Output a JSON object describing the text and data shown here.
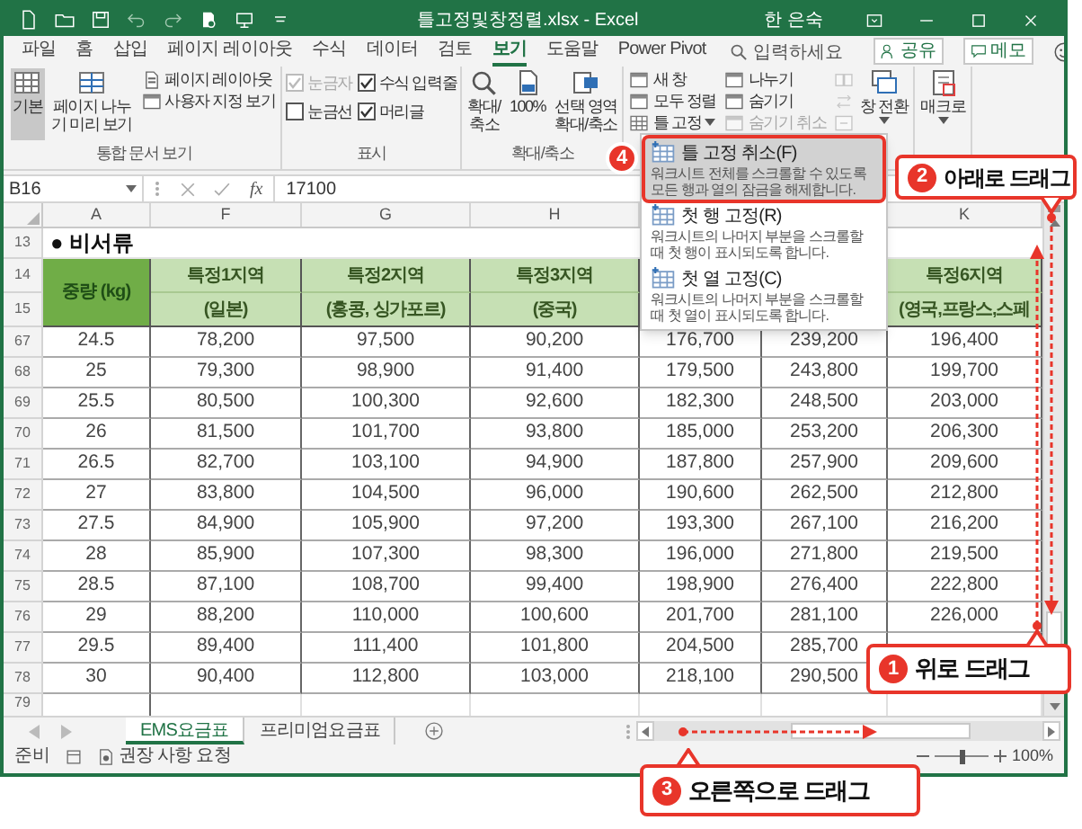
{
  "window": {
    "title": "틀고정및창정렬.xlsx - Excel",
    "user": "한 은숙"
  },
  "ribbon_tabs": [
    {
      "label": "파일",
      "selected": false
    },
    {
      "label": "홈",
      "selected": false
    },
    {
      "label": "삽입",
      "selected": false
    },
    {
      "label": "페이지 레이아웃",
      "selected": false
    },
    {
      "label": "수식",
      "selected": false
    },
    {
      "label": "데이터",
      "selected": false
    },
    {
      "label": "검토",
      "selected": false
    },
    {
      "label": "보기",
      "selected": true
    },
    {
      "label": "도움말",
      "selected": false
    },
    {
      "label": "Power Pivot",
      "selected": false
    }
  ],
  "search": {
    "placeholder": "입력하세요"
  },
  "share_button": "공유",
  "comments_button": "메모",
  "ribbon_groups": [
    {
      "label": "통합 문서 보기",
      "columns": [
        [
          {
            "kind": "large",
            "label": "기본",
            "selected": true
          }
        ],
        [
          {
            "kind": "large",
            "label": "페이지 나누\n기 미리 보기",
            "selected": false
          }
        ],
        [
          {
            "kind": "small",
            "label": "페이지 레이아웃",
            "selected": false
          },
          {
            "kind": "small",
            "label": "사용자 지정 보기",
            "selected": false
          }
        ]
      ]
    },
    {
      "label": "표시",
      "columns": [
        [
          {
            "kind": "check",
            "label": "눈금자",
            "checked": true,
            "disabled": true
          },
          {
            "kind": "check",
            "label": "눈금선",
            "checked": false,
            "disabled": false
          }
        ],
        [
          {
            "kind": "check",
            "label": "수식 입력줄",
            "checked": true,
            "disabled": false
          },
          {
            "kind": "check",
            "label": "머리글",
            "checked": true,
            "disabled": false
          }
        ]
      ]
    },
    {
      "label": "확대/축소",
      "columns": [
        [
          {
            "kind": "large",
            "label": "확대/\n축소"
          }
        ],
        [
          {
            "kind": "large",
            "label": "100%"
          }
        ],
        [
          {
            "kind": "large",
            "label": "선택 영역\n확대/축소"
          }
        ]
      ]
    },
    {
      "columns": [
        [
          {
            "kind": "small",
            "label": "새 창",
            "disabled": false
          },
          {
            "kind": "small",
            "label": "모두 정렬",
            "disabled": false
          },
          {
            "kind": "small",
            "label": "틀 고정",
            "disabled": false,
            "has_menu": true
          }
        ],
        [
          {
            "kind": "small",
            "label": "나누기",
            "disabled": false
          },
          {
            "kind": "small",
            "label": "숨기기",
            "disabled": false
          },
          {
            "kind": "small",
            "label": "숨기기 취소",
            "disabled": true
          }
        ],
        [
          {
            "kind": "icon",
            "disabled": true
          },
          {
            "kind": "icon",
            "disabled": true
          },
          {
            "kind": "icon",
            "disabled": true
          }
        ],
        [
          {
            "kind": "large",
            "label": "창 전환",
            "has_menu": true
          }
        ]
      ]
    },
    {
      "columns": [
        [
          {
            "kind": "large",
            "label": "매크로",
            "has_menu": true
          }
        ]
      ]
    }
  ],
  "freeze_menu": {
    "items": [
      {
        "title": "틀 고정 취소(F)",
        "description": "워크시트 전체를 스크롤할 수 있도록 모든 행과 열의 잠금을 해제합니다.",
        "selected": true
      },
      {
        "title": "첫 행 고정(R)",
        "description": "워크시트의 나머지 부분을 스크롤할 때 첫 행이 표시되도록 합니다.",
        "selected": false
      },
      {
        "title": "첫 열 고정(C)",
        "description": "워크시트의 나머지 부분을 스크롤할 때 첫 열이 표시되도록 합니다.",
        "selected": false
      }
    ]
  },
  "formula_bar": {
    "name_box": "B16",
    "function_label": "fx",
    "value": "17100"
  },
  "sheet": {
    "column_headers": [
      "A",
      "F",
      "G",
      "H",
      "K"
    ],
    "title_row": {
      "row": "13",
      "text": "● 비서류"
    },
    "header_rows": [
      {
        "row": "14",
        "cells": [
          "중량 (kg)",
          "특정1지역",
          "특정2지역",
          "특정3지역",
          null,
          null,
          "특정6지역"
        ]
      },
      {
        "row": "15",
        "cells": [
          null,
          "(일본)",
          "(홍콩, 싱가포르)",
          "(중국)",
          null,
          null,
          "(영국,프랑스,스페"
        ]
      }
    ],
    "rows": [
      {
        "row": "67",
        "cells": [
          "24.5",
          "78,200",
          "97,500",
          "90,200",
          "176,700",
          "239,200",
          "196,400"
        ]
      },
      {
        "row": "68",
        "cells": [
          "25",
          "79,300",
          "98,900",
          "91,400",
          "179,500",
          "243,800",
          "199,700"
        ]
      },
      {
        "row": "69",
        "cells": [
          "25.5",
          "80,500",
          "100,300",
          "92,600",
          "182,300",
          "248,500",
          "203,000"
        ]
      },
      {
        "row": "70",
        "cells": [
          "26",
          "81,500",
          "101,700",
          "93,800",
          "185,000",
          "253,200",
          "206,300"
        ]
      },
      {
        "row": "71",
        "cells": [
          "26.5",
          "82,700",
          "103,100",
          "94,900",
          "187,800",
          "257,900",
          "209,600"
        ]
      },
      {
        "row": "72",
        "cells": [
          "27",
          "83,800",
          "104,500",
          "96,000",
          "190,600",
          "262,500",
          "212,800"
        ]
      },
      {
        "row": "73",
        "cells": [
          "27.5",
          "84,900",
          "105,900",
          "97,200",
          "193,300",
          "267,100",
          "216,200"
        ]
      },
      {
        "row": "74",
        "cells": [
          "28",
          "85,900",
          "107,300",
          "98,300",
          "196,000",
          "271,800",
          "219,500"
        ]
      },
      {
        "row": "75",
        "cells": [
          "28.5",
          "87,100",
          "108,700",
          "99,400",
          "198,900",
          "276,400",
          "222,800"
        ]
      },
      {
        "row": "76",
        "cells": [
          "29",
          "88,200",
          "110,000",
          "100,600",
          "201,700",
          "281,100",
          "226,000"
        ]
      },
      {
        "row": "77",
        "cells": [
          "29.5",
          "89,400",
          "111,400",
          "101,800",
          "204,500",
          "285,700",
          null
        ]
      },
      {
        "row": "78",
        "cells": [
          "30",
          "90,400",
          "112,800",
          "103,000",
          "218,100",
          "290,500",
          null
        ]
      }
    ],
    "last_row": "79"
  },
  "sheet_tabs": [
    {
      "label": "EMS요금표",
      "selected": true
    },
    {
      "label": "프리미엄요금표",
      "selected": false
    }
  ],
  "status_bar": {
    "mode": "준비",
    "accessibility": "권장 사항 요청",
    "zoom_slider": {
      "level": 0.5
    },
    "zoom": "100%"
  },
  "annotations": [
    {
      "kind": "badge",
      "number": "4"
    },
    {
      "kind": "callout",
      "number": "2",
      "text": "아래로 드래그"
    },
    {
      "kind": "callout",
      "number": "1",
      "text": "위로 드래그"
    },
    {
      "kind": "callout",
      "number": "3",
      "text": "오른쪽으로 드래그"
    }
  ]
}
